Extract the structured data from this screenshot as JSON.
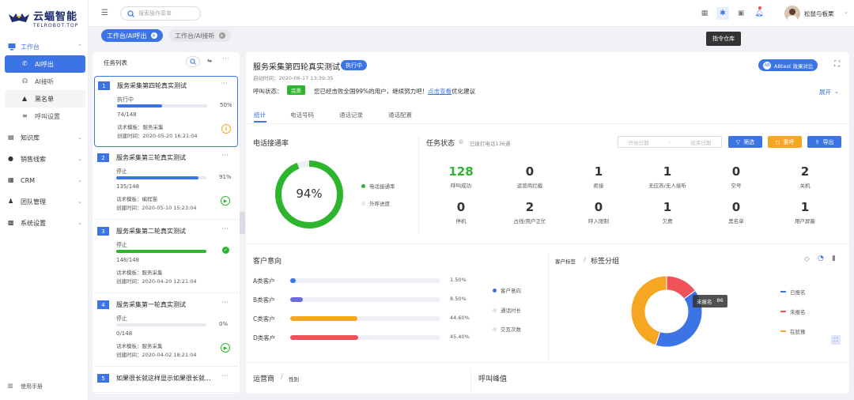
{
  "brand": {
    "name": "云蝠智能",
    "sub": "TELROBOT.TOP"
  },
  "sidebar": {
    "items": [
      {
        "label": "工作台"
      },
      {
        "label": "AI呼出"
      },
      {
        "label": "AI接听"
      },
      {
        "label": "黑名单"
      },
      {
        "label": "呼叫设置"
      },
      {
        "label": "知识库"
      },
      {
        "label": "销售线索"
      },
      {
        "label": "CRM"
      },
      {
        "label": "团队管理"
      },
      {
        "label": "系统设置"
      }
    ],
    "manual": "使用手册"
  },
  "header": {
    "search_placeholder": "搜索操作菜单",
    "user": "松鼠与板栗",
    "tooltip": "指令仓库",
    "tabs": [
      {
        "label": "工作台/AI呼出"
      },
      {
        "label": "工作台/AI接听"
      }
    ]
  },
  "tasklist": {
    "title": "任务列表",
    "cards": [
      {
        "num": "1",
        "title": "服务采集第四轮真实测试",
        "status": "执行中",
        "pct": "50%",
        "count": "74/148",
        "tpl": "话术模板：服务采集",
        "time": "创建时间：2020-05-20 16:21:04",
        "progress": 0.5,
        "color": "#3c74e6",
        "action": "pause"
      },
      {
        "num": "2",
        "title": "服务采集第三轮真实测试",
        "status": "停止",
        "pct": "91%",
        "count": "135/148",
        "tpl": "话术模板：编程猫",
        "time": "创建时间：2020-05-10 15:23:04",
        "progress": 0.91,
        "color": "#3c74e6",
        "action": "play"
      },
      {
        "num": "3",
        "title": "服务采集第二轮真实测试",
        "status": "停止",
        "pct": "",
        "count": "148/148",
        "tpl": "话术模板：服务采集",
        "time": "创建时间：2020-04-20 12:21:04",
        "progress": 1.0,
        "color": "#2db52d",
        "action": "done"
      },
      {
        "num": "4",
        "title": "服务采集第一轮真实测试",
        "status": "停止",
        "pct": "0%",
        "count": "0/148",
        "tpl": "话术模板：服务采集",
        "time": "创建时间：2020-04-02 18:21:04",
        "progress": 0,
        "color": "#3c74e6",
        "action": "play"
      },
      {
        "num": "5",
        "title": "如果很长就这样显示如果很长就...",
        "status": "",
        "pct": "",
        "count": "",
        "tpl": "",
        "time": "",
        "progress": 0,
        "color": "#3c74e6",
        "action": ""
      }
    ]
  },
  "task": {
    "title": "服务采集第四轮真实测试",
    "badge": "执行中",
    "start": "启动时间：2020-06-17  13:39:35",
    "call_status_label": "呼叫状态：",
    "call_status_badge": "完美",
    "call_msg": "您已经击败全国99%的用户，继续努力吧！",
    "call_link": "点击查看",
    "call_tail": "优化建议",
    "abtest": "ABtest 效果对比",
    "expand": "展开",
    "tabs": [
      "统计",
      "电话号码",
      "通话记录",
      "通话配置"
    ]
  },
  "connect": {
    "title": "电话接通率",
    "value": "94%",
    "rate": 0.94,
    "legend": [
      "电话接通率",
      "外呼进度"
    ]
  },
  "status": {
    "title": "任务状态",
    "sub": "已拨打电话136通",
    "date_start": "开始日期",
    "date_sep": "-",
    "date_end": "结束日期",
    "btns": [
      "筛选",
      "重呼",
      "导出"
    ],
    "stats": [
      {
        "v": "128",
        "l": "呼叫成功",
        "green": true
      },
      {
        "v": "0",
        "l": "运营商拦截"
      },
      {
        "v": "1",
        "l": "拒接"
      },
      {
        "v": "1",
        "l": "无应答/无人接听"
      },
      {
        "v": "0",
        "l": "空号"
      },
      {
        "v": "2",
        "l": "关机"
      },
      {
        "v": "0",
        "l": "停机"
      },
      {
        "v": "2",
        "l": "占线/用户正忙"
      },
      {
        "v": "0",
        "l": "呼入限制"
      },
      {
        "v": "1",
        "l": "欠费"
      },
      {
        "v": "0",
        "l": "黑名单"
      },
      {
        "v": "1",
        "l": "用户屏蔽"
      }
    ]
  },
  "intent": {
    "title": "客户意向",
    "rows": [
      {
        "label": "A类客户",
        "pct": "1.50%",
        "value": 0.015,
        "color": "#3c74e6"
      },
      {
        "label": "B类客户",
        "pct": "8.50%",
        "value": 0.085,
        "color": "#6b6bd9"
      },
      {
        "label": "C类客户",
        "pct": "44.60%",
        "value": 0.446,
        "color": "#f5a623"
      },
      {
        "label": "D类客户",
        "pct": "45.40%",
        "value": 0.454,
        "color": "#f0525a"
      }
    ],
    "legend": [
      "客户意向",
      "通话时长",
      "交互次数"
    ]
  },
  "tags": {
    "crumb1": "客户标签",
    "sep": "/",
    "crumb2": "标签分组",
    "tooltip_label": "未报名",
    "tooltip_value": "86",
    "legend": [
      {
        "label": "已报名",
        "color": "#3c74e6"
      },
      {
        "label": "未报名",
        "color": "#f0525a"
      },
      {
        "label": "在犹豫",
        "color": "#f5a623"
      }
    ],
    "chart_data": {
      "type": "pie",
      "categories": [
        "已报名",
        "未报名",
        "在犹豫"
      ],
      "values": [
        40,
        15,
        45
      ]
    }
  },
  "bottom": {
    "left1": "运营商",
    "sep": "/",
    "left2": "性别",
    "right": "呼叫峰值"
  }
}
